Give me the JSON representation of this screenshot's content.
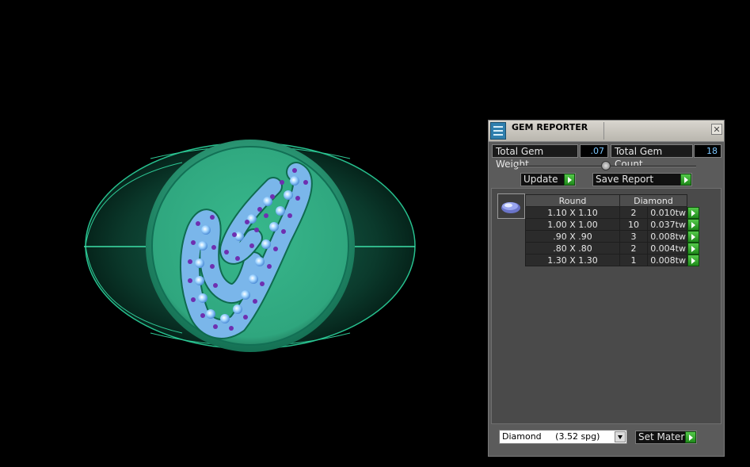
{
  "panel": {
    "title": "GEM REPORTER",
    "close_glyph": "✕",
    "total_gem_weight_label": "Total Gem Weight",
    "total_gem_weight_value": ".07",
    "total_gem_count_label": "Total Gem Count",
    "total_gem_count_value": "18",
    "update_label": "Update",
    "save_report_label": "Save Report",
    "table": {
      "col_shape": "Round",
      "col_material": "Diamond",
      "rows": [
        {
          "size": "1.10 X 1.10",
          "qty": "2",
          "weight": "0.010tw"
        },
        {
          "size": "1.00 X 1.00",
          "qty": "10",
          "weight": "0.037tw"
        },
        {
          "size": ".90 X .90",
          "qty": "3",
          "weight": "0.008tw"
        },
        {
          "size": ".80 X .80",
          "qty": "2",
          "weight": "0.004tw"
        },
        {
          "size": "1.30 X 1.30",
          "qty": "1",
          "weight": "0.008tw"
        }
      ]
    },
    "material_select": {
      "name": "Diamond",
      "spg": "(3.52 spg)"
    },
    "set_material_label": "Set Material"
  },
  "colors": {
    "ring_green": "#34b48a",
    "gem_blue": "#7ec0ff",
    "prong_purple": "#7b3db7",
    "button_green": "#3aad32"
  },
  "icons": [
    "close-icon",
    "play-arrow-icon",
    "dropdown-arrow-icon",
    "gem-icon",
    "slider-thumb-icon"
  ]
}
